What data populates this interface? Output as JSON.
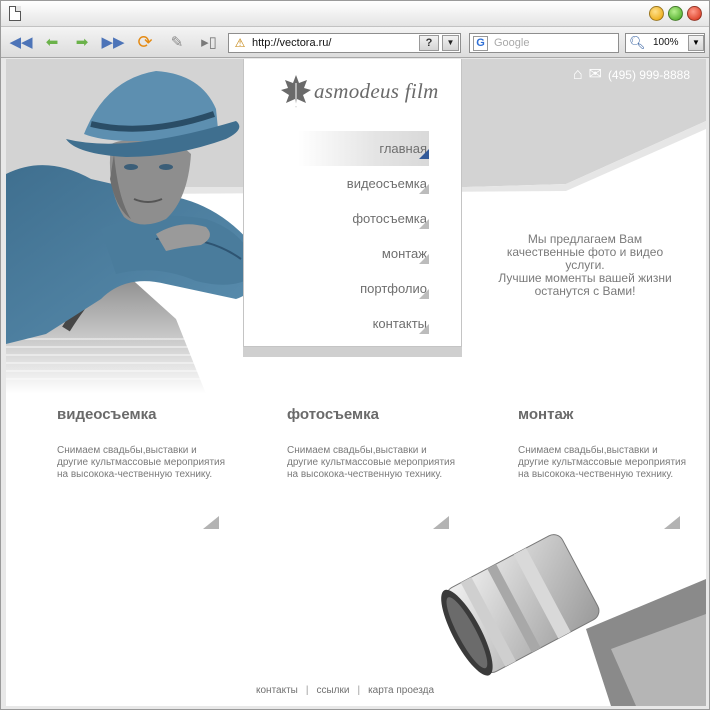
{
  "toolbar": {
    "address_url": "http://vectora.ru/",
    "help_label": "?",
    "search_placeholder": "Google",
    "search_engine_letter": "G",
    "zoom_value": "100%"
  },
  "header": {
    "phone": "(495) 999-8888"
  },
  "logo": {
    "text": "asmodeus film"
  },
  "menu": {
    "items": [
      {
        "label": "главная",
        "active": true
      },
      {
        "label": "видеосъемка",
        "active": false
      },
      {
        "label": "фотосъемка",
        "active": false
      },
      {
        "label": "монтаж",
        "active": false
      },
      {
        "label": "портфолио",
        "active": false
      },
      {
        "label": "контакты",
        "active": false
      }
    ]
  },
  "promo": {
    "lines": [
      "Мы предлагаем Вам",
      "качественные фото и видео",
      "услуги.",
      "Лучшие моменты вашей жизни",
      "останутся с Вами!"
    ]
  },
  "features": [
    {
      "title": "видеосъемка",
      "text": "Снимаем свадьбы,выставки и другие культмассовые мероприятия на высокока-чественную технику."
    },
    {
      "title": "фотосъемка",
      "text": "Снимаем свадьбы,выставки и другие культмассовые мероприятия на высокока-чественную технику."
    },
    {
      "title": "монтаж",
      "text": "Снимаем свадьбы,выставки и другие культмассовые мероприятия на высокока-чественную технику."
    }
  ],
  "footer": {
    "links": [
      "контакты",
      "ссылки",
      "карта проезда"
    ],
    "separator": "|"
  },
  "colors": {
    "accent_blue": "#345b9a",
    "hero_blue": "#4e7e9c",
    "band_gray": "#d3d3d3"
  }
}
